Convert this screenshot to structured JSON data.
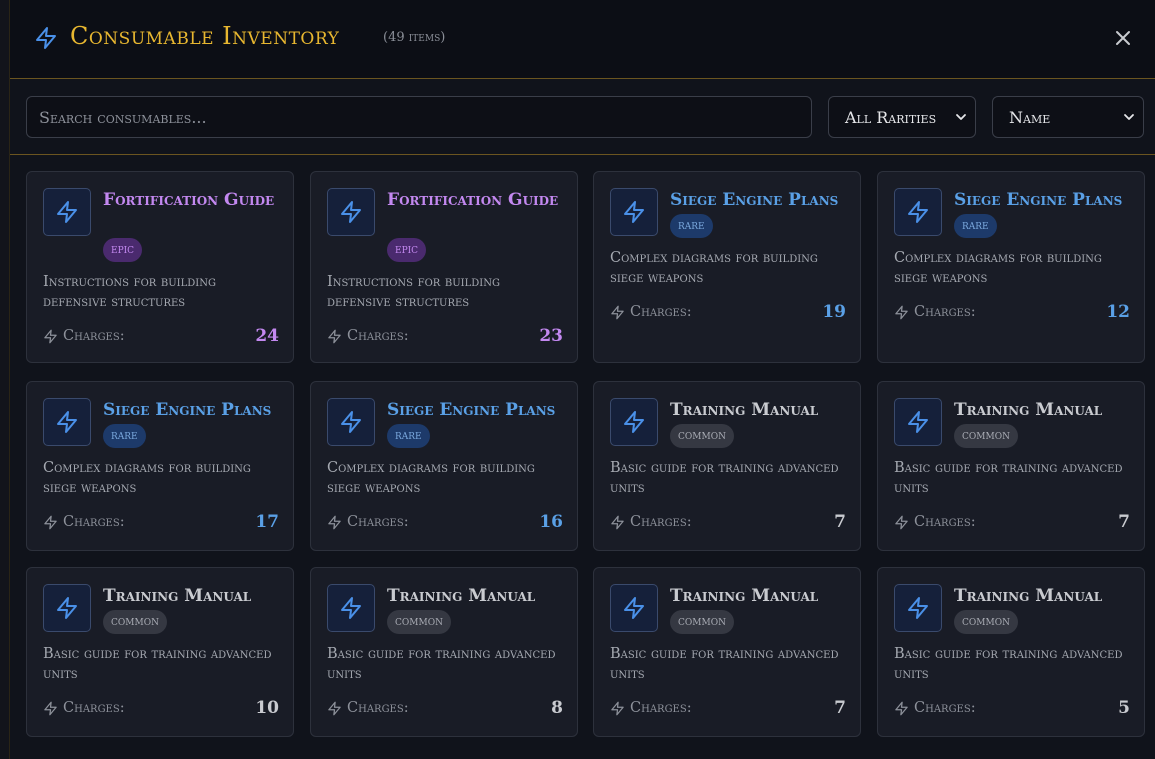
{
  "header": {
    "title": "Consumable Inventory",
    "count": "(49 items)"
  },
  "toolbar": {
    "search_placeholder": "Search consumables...",
    "rarity_selected": "All Rarities",
    "sort_selected": "Name"
  },
  "colors": {
    "gold": "#e8b730",
    "epic": "#c388f0",
    "rare": "#5aa0e6",
    "common": "#c9cbd0",
    "icon": "#4a90e8"
  },
  "charges_label": "Charges:",
  "items": [
    {
      "name": "Fortification Guide",
      "rarity": "epic",
      "desc": "Instructions for building defensive structures",
      "charges": "24"
    },
    {
      "name": "Fortification Guide",
      "rarity": "epic",
      "desc": "Instructions for building defensive structures",
      "charges": "23"
    },
    {
      "name": "Siege Engine Plans",
      "rarity": "rare",
      "desc": "Complex diagrams for building siege weapons",
      "charges": "19"
    },
    {
      "name": "Siege Engine Plans",
      "rarity": "rare",
      "desc": "Complex diagrams for building siege weapons",
      "charges": "12"
    },
    {
      "name": "Siege Engine Plans",
      "rarity": "rare",
      "desc": "Complex diagrams for building siege weapons",
      "charges": "17"
    },
    {
      "name": "Siege Engine Plans",
      "rarity": "rare",
      "desc": "Complex diagrams for building siege weapons",
      "charges": "16"
    },
    {
      "name": "Training Manual",
      "rarity": "common",
      "desc": "Basic guide for training advanced units",
      "charges": "7"
    },
    {
      "name": "Training Manual",
      "rarity": "common",
      "desc": "Basic guide for training advanced units",
      "charges": "7"
    },
    {
      "name": "Training Manual",
      "rarity": "common",
      "desc": "Basic guide for training advanced units",
      "charges": "10"
    },
    {
      "name": "Training Manual",
      "rarity": "common",
      "desc": "Basic guide for training advanced units",
      "charges": "8"
    },
    {
      "name": "Training Manual",
      "rarity": "common",
      "desc": "Basic guide for training advanced units",
      "charges": "7"
    },
    {
      "name": "Training Manual",
      "rarity": "common",
      "desc": "Basic guide for training advanced units",
      "charges": "5"
    }
  ]
}
